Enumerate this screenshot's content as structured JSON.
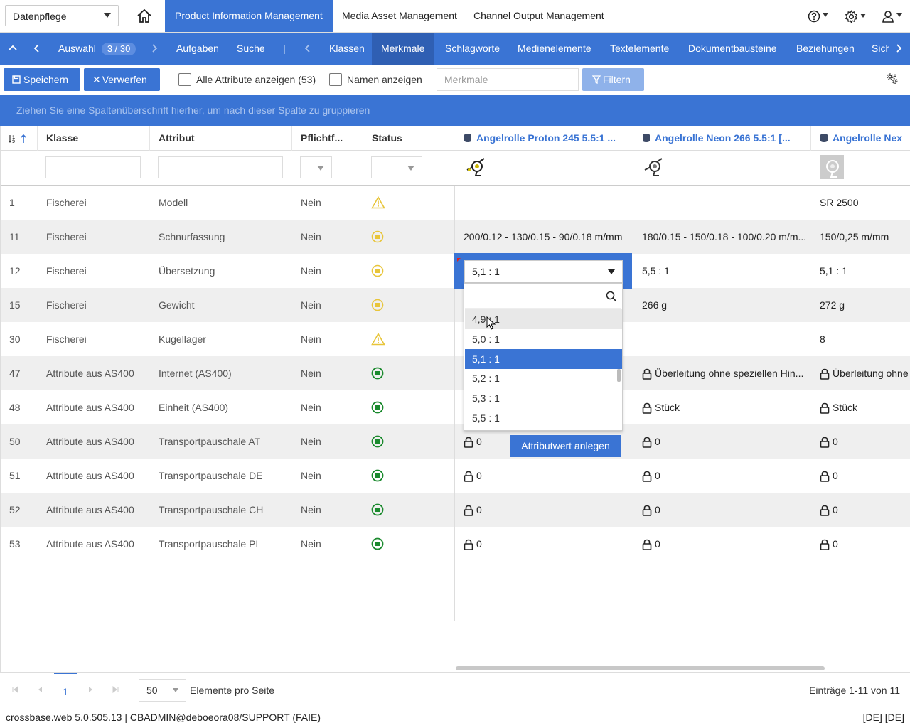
{
  "topbar": {
    "workspace": "Datenpflege",
    "app_tabs": [
      "Product Information Management",
      "Media Asset Management",
      "Channel Output Management"
    ]
  },
  "navbar": {
    "selection_label": "Auswahl",
    "selection_count": "3 / 30",
    "items": [
      "Aufgaben",
      "Suche",
      "|",
      "Klassen",
      "Merkmale",
      "Schlagworte",
      "Medienelemente",
      "Textelemente",
      "Dokumentbausteine",
      "Beziehungen",
      "Sich"
    ],
    "active": "Merkmale"
  },
  "toolbar": {
    "save_label": "Speichern",
    "discard_label": "Verwerfen",
    "show_all_label": "Alle Attribute anzeigen (53)",
    "show_names_label": "Namen anzeigen",
    "search_placeholder": "Merkmale",
    "filter_label": "Filtern"
  },
  "group_panel": "Ziehen Sie eine Spaltenüberschrift hierher, um nach dieser Spalte zu gruppieren",
  "grid": {
    "columns": [
      "Klasse",
      "Attribut",
      "Pflichtf...",
      "Status",
      "Angelrolle Proton 245 5.5:1 ...",
      "Angelrolle Neon 266 5.5:1 [...",
      "Angelrolle Nex"
    ],
    "rows": [
      {
        "num": "1",
        "klasse": "Fischerei",
        "attribut": "Modell",
        "pflicht": "Nein",
        "status": "warning",
        "p1": "",
        "p2": "",
        "p3": "SR 2500",
        "locked": false
      },
      {
        "num": "11",
        "klasse": "Fischerei",
        "attribut": "Schnurfassung",
        "pflicht": "Nein",
        "status": "pending",
        "p1": "200/0.12 - 130/0.15 - 90/0.18 m/mm",
        "p2": "180/0.15 - 150/0.18 - 100/0.20 m/m...",
        "p3": "150/0,25 m/mm",
        "locked": false
      },
      {
        "num": "12",
        "klasse": "Fischerei",
        "attribut": "Übersetzung",
        "pflicht": "Nein",
        "status": "pending",
        "p1": "",
        "p2": "5,5 : 1",
        "p3": "5,1 : 1",
        "locked": false
      },
      {
        "num": "15",
        "klasse": "Fischerei",
        "attribut": "Gewicht",
        "pflicht": "Nein",
        "status": "pending",
        "p1": "",
        "p2": "266 g",
        "p3": "272 g",
        "locked": false
      },
      {
        "num": "30",
        "klasse": "Fischerei",
        "attribut": "Kugellager",
        "pflicht": "Nein",
        "status": "warning",
        "p1": "",
        "p2": "",
        "p3": "8",
        "locked": false
      },
      {
        "num": "47",
        "klasse": "Attribute aus AS400",
        "attribut": "Internet (AS400)",
        "pflicht": "Nein",
        "status": "ok",
        "p1": "",
        "p2": "Überleitung ohne speziellen Hin...",
        "p3": "Überleitung ohne",
        "locked": true
      },
      {
        "num": "48",
        "klasse": "Attribute aus AS400",
        "attribut": "Einheit (AS400)",
        "pflicht": "Nein",
        "status": "ok",
        "p1": "",
        "p2": "Stück",
        "p3": "Stück",
        "locked": true
      },
      {
        "num": "50",
        "klasse": "Attribute aus AS400",
        "attribut": "Transportpauschale AT",
        "pflicht": "Nein",
        "status": "ok",
        "p1": "0",
        "p2": "0",
        "p3": "0",
        "locked": true
      },
      {
        "num": "51",
        "klasse": "Attribute aus AS400",
        "attribut": "Transportpauschale DE",
        "pflicht": "Nein",
        "status": "ok",
        "p1": "0",
        "p2": "0",
        "p3": "0",
        "locked": true
      },
      {
        "num": "52",
        "klasse": "Attribute aus AS400",
        "attribut": "Transportpauschale CH",
        "pflicht": "Nein",
        "status": "ok",
        "p1": "0",
        "p2": "0",
        "p3": "0",
        "locked": true
      },
      {
        "num": "53",
        "klasse": "Attribute aus AS400",
        "attribut": "Transportpauschale PL",
        "pflicht": "Nein",
        "status": "ok",
        "p1": "0",
        "p2": "0",
        "p3": "0",
        "locked": true
      }
    ]
  },
  "editor": {
    "value": "5,1 : 1",
    "options": [
      "4,9 : 1",
      "5,0 : 1",
      "5,1 : 1",
      "5,2 : 1",
      "5,3 : 1",
      "5,5 : 1"
    ],
    "selected": "5,1 : 1",
    "hovered": "4,9 : 1",
    "create_label": "Attributwert anlegen"
  },
  "pager": {
    "page": "1",
    "page_size": "50",
    "page_size_label": "Elemente pro Seite",
    "entries": "Einträge 1-11 von 11"
  },
  "footer": {
    "left": "crossbase.web 5.0.505.13 | CBADMIN@deboeora08/SUPPORT (FAIE)",
    "right": "[DE] [DE]"
  },
  "colors": {
    "accent": "#3a74d4",
    "warning": "#e8c53a",
    "ok": "#1b8a2e"
  }
}
